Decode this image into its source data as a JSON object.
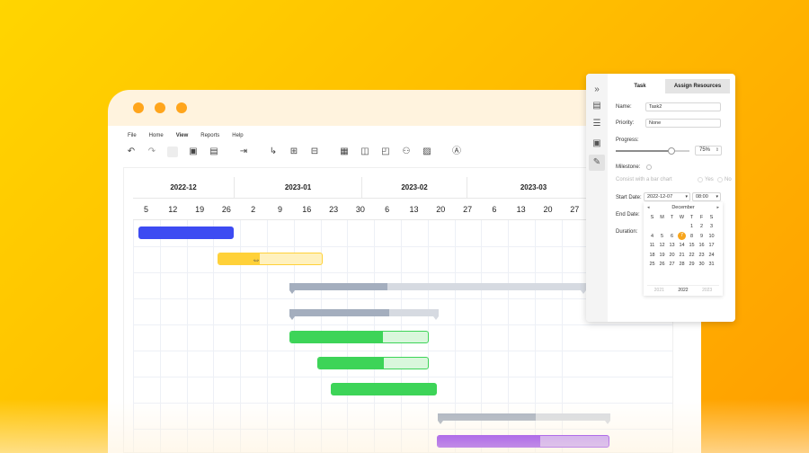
{
  "menu": [
    "File",
    "Home",
    "View",
    "Reports",
    "Help"
  ],
  "menu_active": "View",
  "toolbar_icons": [
    "undo-icon",
    "redo-icon",
    "blank-icon",
    "save-icon",
    "table-icon",
    "indent-icon",
    "link-icon",
    "add-task-icon",
    "add-subtask-icon",
    "view-a-icon",
    "view-b-icon",
    "view-c-icon",
    "resource-icon",
    "report-icon",
    "text-icon"
  ],
  "timeline": {
    "months": [
      "2022-12",
      "2023-01",
      "2023-02",
      "2023-03"
    ],
    "days": [
      "5",
      "12",
      "19",
      "26",
      "2",
      "9",
      "16",
      "23",
      "30",
      "6",
      "13",
      "20",
      "27",
      "6",
      "13",
      "20",
      "27"
    ]
  },
  "tasks": [
    {
      "type": "task",
      "color": "#3D4BF2",
      "rest": "#3D4BF2",
      "progress": 1.0
    },
    {
      "type": "task",
      "color": "#FFD139",
      "rest": "#FFF1BE",
      "progress": 0.4
    },
    {
      "type": "summary",
      "progress": 0.33
    },
    {
      "type": "summary",
      "progress": 0.67
    },
    {
      "type": "task",
      "color": "#3DD458",
      "rest": "#D9F7DC",
      "progress": 0.67
    },
    {
      "type": "task",
      "color": "#3DD458",
      "rest": "#D9F7DC",
      "progress": 0.6
    },
    {
      "type": "task",
      "color": "#3DD458",
      "rest": "#3DD458",
      "progress": 1.0
    },
    {
      "type": "summary",
      "progress": 0.57
    },
    {
      "type": "task",
      "color": "#7A12F0",
      "rest": "#B98BF6",
      "progress": 0.6
    }
  ],
  "panel": {
    "tabs": {
      "task": "Task",
      "assign": "Assign Resources"
    },
    "name_label": "Name:",
    "name_value": "Task2",
    "priority_label": "Priority:",
    "priority_value": "None",
    "progress_label": "Progress:",
    "progress_value": "75%",
    "progress_fraction": 0.75,
    "milestone_label": "Milestone:",
    "bar_chart_label": "Consist with a bar chart",
    "yes": "Yes",
    "no": "No",
    "start_label": "Start Date:",
    "start_date": "2022-12-07",
    "start_time": "08:00",
    "end_label": "End Date:",
    "duration_label": "Duration:",
    "calendar": {
      "month": "December",
      "weekdays": [
        "S",
        "M",
        "T",
        "W",
        "T",
        "F",
        "S"
      ],
      "dates": [
        "",
        "",
        "",
        "",
        "1",
        "2",
        "3",
        "4",
        "5",
        "6",
        "7",
        "8",
        "9",
        "10",
        "11",
        "12",
        "13",
        "14",
        "15",
        "16",
        "17",
        "18",
        "19",
        "20",
        "21",
        "22",
        "23",
        "24",
        "25",
        "26",
        "27",
        "28",
        "29",
        "30",
        "31"
      ],
      "selected": "7",
      "years": [
        "2021",
        "2022",
        "2023"
      ],
      "current_year": "2022"
    }
  }
}
